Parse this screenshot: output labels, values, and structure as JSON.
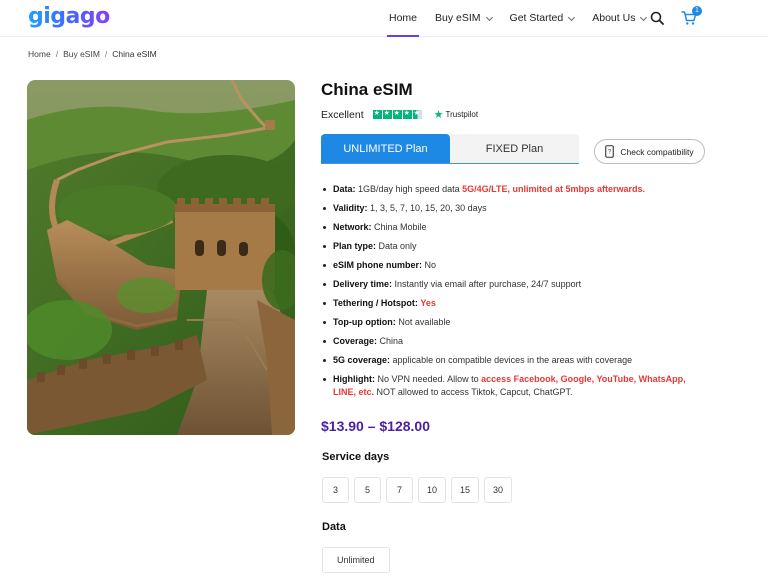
{
  "header": {
    "logo": "gigago",
    "nav": [
      {
        "label": "Home"
      },
      {
        "label": "Buy eSIM"
      },
      {
        "label": "Get Started"
      },
      {
        "label": "About Us"
      }
    ],
    "cart_count": "1"
  },
  "breadcrumb": {
    "items": [
      "Home",
      "Buy eSIM",
      "China eSIM"
    ],
    "separator": "/"
  },
  "product": {
    "title": "China eSIM",
    "rating_label": "Excellent",
    "trustpilot": "Trustpilot",
    "plan_tabs": [
      "UNLIMITED Plan",
      "FIXED Plan"
    ],
    "compat_button": "Check compatibility",
    "specs": {
      "data_label": "Data:",
      "data_text": "1GB/day high speed data",
      "data_red": "5G/4G/LTE, unlimited at 5mbps afterwards.",
      "validity_label": "Validity:",
      "validity_text": "1, 3, 5, 7, 10, 15, 20, 30 days",
      "network_label": "Network:",
      "network_text": "China Mobile",
      "plantype_label": "Plan type:",
      "plantype_text": "Data only",
      "phone_label": "eSIM phone number:",
      "phone_text": "No",
      "delivery_label": "Delivery time:",
      "delivery_text": "Instantly via email after purchase, 24/7 support",
      "tether_label": "Tethering / Hotspot:",
      "tether_red": "Yes",
      "topup_label": "Top-up option:",
      "topup_text": "Not available",
      "coverage_label": "Coverage:",
      "coverage_text": "China",
      "fiveg_label": "5G coverage:",
      "fiveg_text": "applicable on compatible devices in the areas with coverage",
      "highlight_label": "Highlight:",
      "highlight_text1": "No VPN needed. Allow to",
      "highlight_red": "access Facebook, Google, YouTube, WhatsApp, LINE, etc.",
      "highlight_text2": "NOT allowed to access Tiktok, Capcut, ChatGPT."
    },
    "price": "$13.90 – $128.00",
    "service_days_label": "Service days",
    "service_days": [
      "3",
      "5",
      "7",
      "10",
      "15",
      "30"
    ],
    "data_label": "Data",
    "data_options": [
      "Unlimited"
    ]
  },
  "colors": {
    "accent": "#1e88e5",
    "price": "#4a1fa8",
    "highlight": "#e53935",
    "trustpilot": "#00b67a"
  }
}
